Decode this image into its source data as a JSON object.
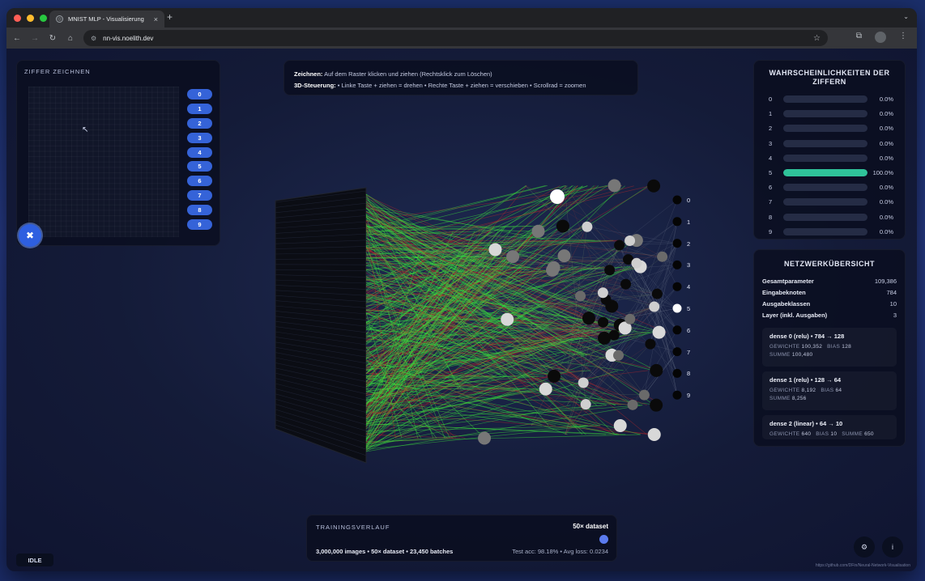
{
  "browser": {
    "tab_title": "MNIST MLP - Visualisierung",
    "url": "nn-vis.noelith.dev"
  },
  "draw_panel": {
    "title": "ZIFFER ZEICHNEN",
    "digits": [
      "0",
      "1",
      "2",
      "3",
      "4",
      "5",
      "6",
      "7",
      "8",
      "9"
    ],
    "clear_icon": "close-icon"
  },
  "instructions": {
    "draw_label": "Zeichnen:",
    "draw_text": "Auf dem Raster klicken und ziehen (Rechtsklick zum Löschen)",
    "control_label": "3D-Steuerung:",
    "control_text": "• Linke Taste + ziehen = drehen • Rechte Taste + ziehen = verschieben • Scrollrad = zoomen"
  },
  "probabilities": {
    "title": "WAHRSCHEINLICHKEITEN DER ZIFFERN",
    "accent_color": "#2fc39a",
    "rows": [
      {
        "digit": "0",
        "value": 0.0,
        "label": "0.0%"
      },
      {
        "digit": "1",
        "value": 0.0,
        "label": "0.0%"
      },
      {
        "digit": "2",
        "value": 0.0,
        "label": "0.0%"
      },
      {
        "digit": "3",
        "value": 0.0,
        "label": "0.0%"
      },
      {
        "digit": "4",
        "value": 0.0,
        "label": "0.0%"
      },
      {
        "digit": "5",
        "value": 1.0,
        "label": "100.0%"
      },
      {
        "digit": "6",
        "value": 0.0,
        "label": "0.0%"
      },
      {
        "digit": "7",
        "value": 0.0,
        "label": "0.0%"
      },
      {
        "digit": "8",
        "value": 0.0,
        "label": "0.0%"
      },
      {
        "digit": "9",
        "value": 0.0,
        "label": "0.0%"
      }
    ]
  },
  "network": {
    "title": "NETZWERKÜBERSICHT",
    "stats": [
      {
        "label": "Gesamtparameter",
        "value": "109,386"
      },
      {
        "label": "Eingabeknoten",
        "value": "784"
      },
      {
        "label": "Ausgabeklassen",
        "value": "10"
      },
      {
        "label": "Layer (inkl. Ausgaben)",
        "value": "3"
      }
    ],
    "layers": [
      {
        "title": "dense 0 (relu) • 784 → 128",
        "line1": [
          "GEWICHTE",
          "100,352",
          "BIAS",
          "128"
        ],
        "line2": [
          "SUMME",
          "100,480"
        ]
      },
      {
        "title": "dense 1 (relu) • 128 → 64",
        "line1": [
          "GEWICHTE",
          "8,192",
          "BIAS",
          "64"
        ],
        "line2": [
          "SUMME",
          "8,256"
        ]
      },
      {
        "title": "dense 2 (linear) • 64 → 10",
        "line1": [
          "GEWICHTE",
          "640",
          "BIAS",
          "10",
          "SUMME",
          "650"
        ],
        "line2": []
      }
    ]
  },
  "training": {
    "title": "TRAININGSVERLAUF",
    "dataset": "50× dataset",
    "info": "3,000,000 images • 50× dataset • 23,450 batches",
    "accuracy": "Test acc: 98.18% • Avg loss: 0.0234"
  },
  "status": "IDLE",
  "output_labels": [
    "0",
    "1",
    "2",
    "3",
    "4",
    "5",
    "6",
    "7",
    "8",
    "9"
  ],
  "footer": "https://github.com/DFin/Neural-Network-Visualisation"
}
